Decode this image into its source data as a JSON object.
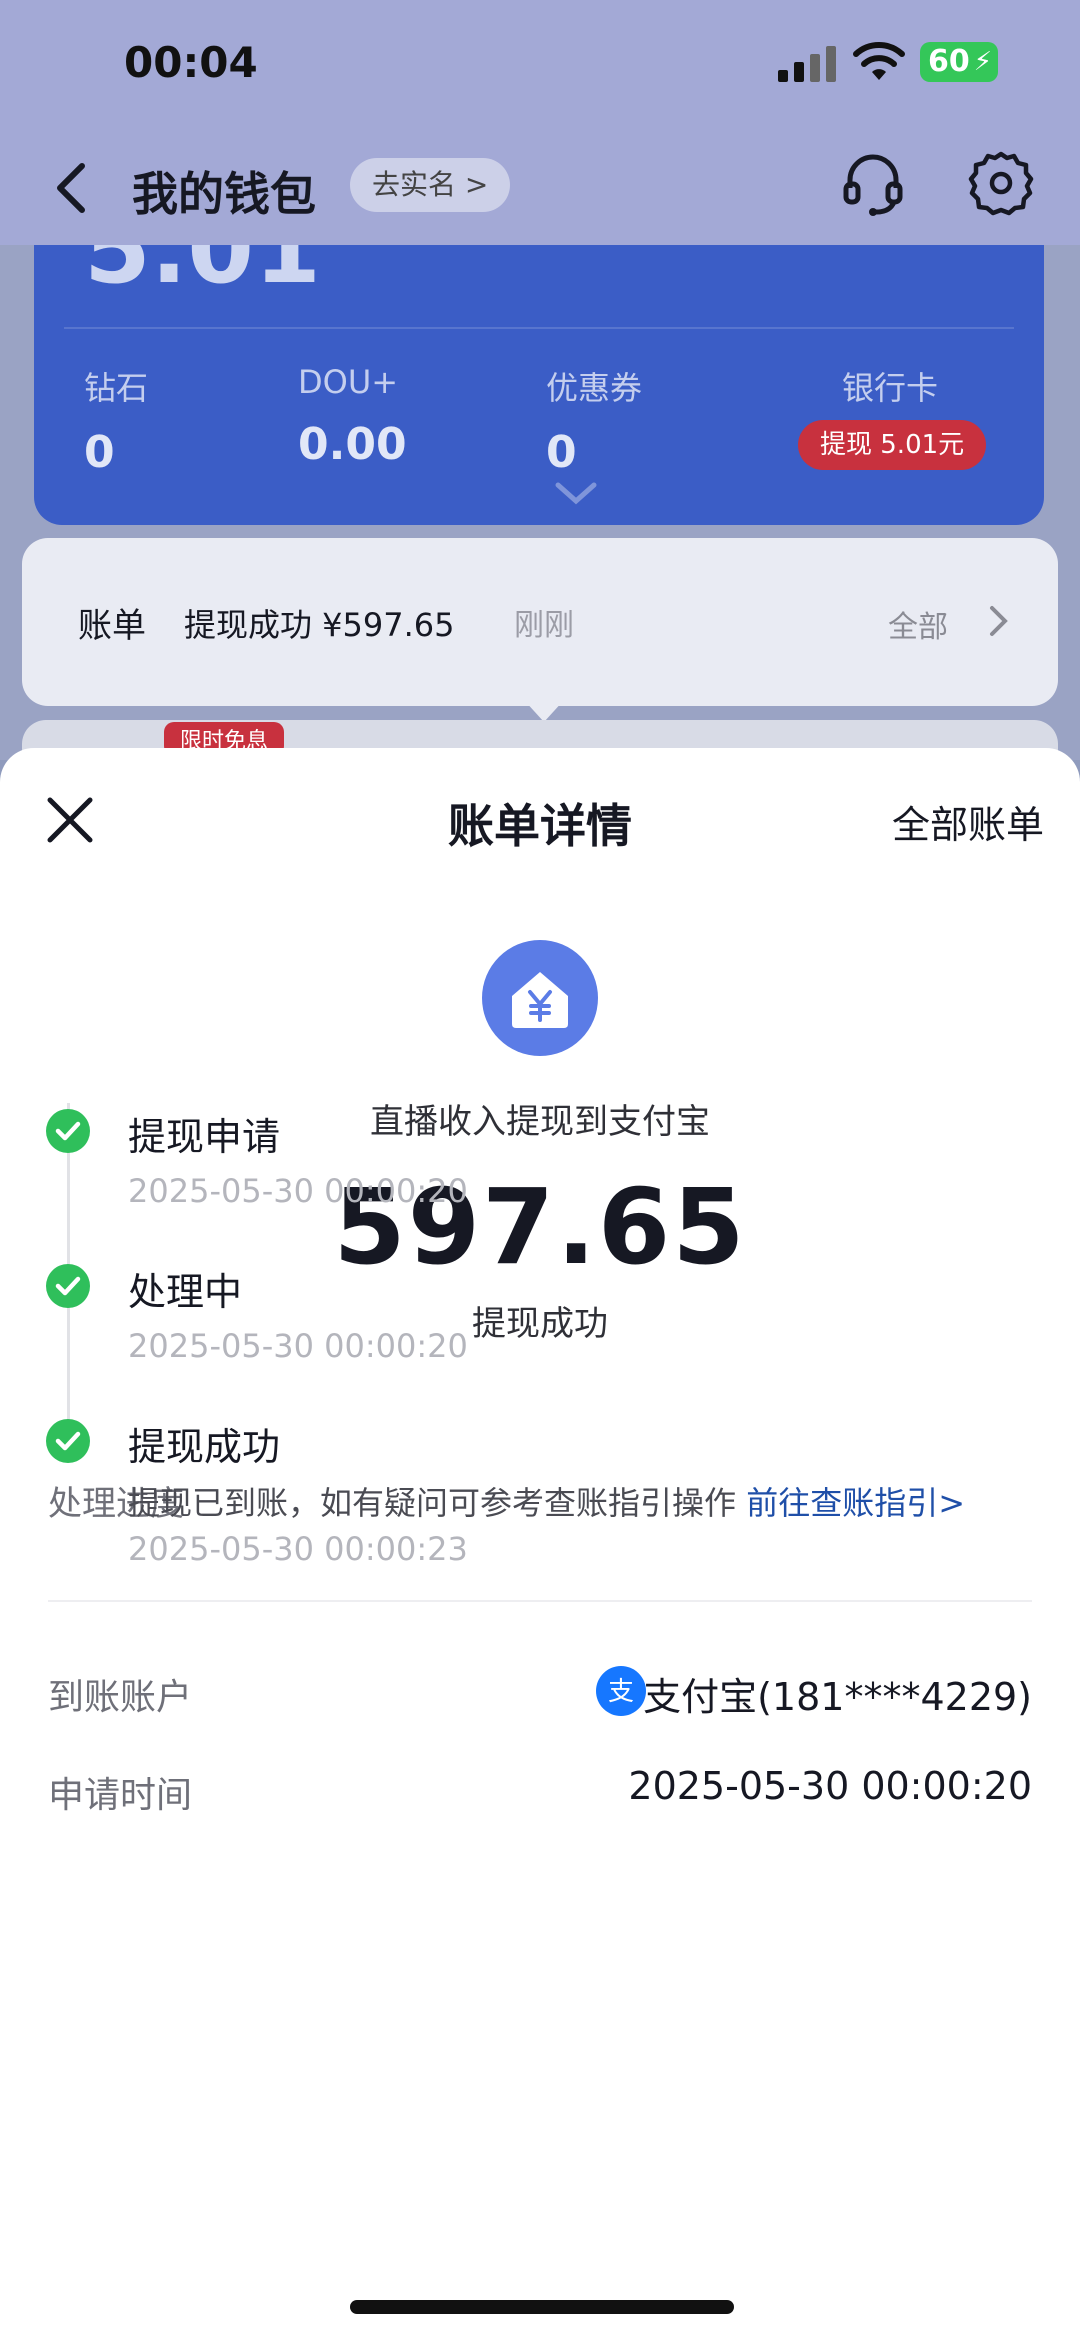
{
  "status_bar": {
    "time": "00:04",
    "battery": "60"
  },
  "nav": {
    "title": "我的钱包",
    "verify_label": "去实名 >"
  },
  "wallet": {
    "balance_partial": "5.01",
    "stats": [
      {
        "label": "钻石",
        "value": "0"
      },
      {
        "label": "DOU+",
        "value": "0.00"
      },
      {
        "label": "优惠券",
        "value": "0"
      },
      {
        "label": "银行卡",
        "value": ""
      }
    ],
    "withdraw_pill": "提现 5.01元",
    "bill_label": "账单",
    "bill_text": "提现成功 ¥597.65",
    "bill_time": "刚刚",
    "bill_all": "全部",
    "promo_badge": "限时免息"
  },
  "sheet": {
    "title": "账单详情",
    "all_bills": "全部账单",
    "description": "直播收入提现到支付宝",
    "amount": "597.65",
    "status": "提现成功",
    "progress_title": "处理进度",
    "steps": [
      {
        "label": "提现申请",
        "time": "2025-05-30 00:00:20"
      },
      {
        "label": "处理中",
        "time": "2025-05-30 00:00:20"
      },
      {
        "label": "提现成功",
        "time": "2025-05-30 00:00:23",
        "note": "提现已到账，如有疑问可参考查账指引操作 ",
        "note_link": "前往查账指引>"
      }
    ],
    "rows": [
      {
        "label": "到账账户",
        "value": "支付宝(181****4229)"
      },
      {
        "label": "申请时间",
        "value": "2025-05-30 00:00:20"
      }
    ]
  },
  "colors": {
    "accent_blue": "#3b5dc6",
    "success_green": "#2fbf5b",
    "red_badge": "#c8313e",
    "link_blue": "#1f4fa8"
  },
  "icons": [
    "back-arrow-icon",
    "headset-icon",
    "gear-icon",
    "close-icon",
    "yen-house-icon",
    "check-icon",
    "alipay-icon",
    "chevron-right-icon"
  ]
}
